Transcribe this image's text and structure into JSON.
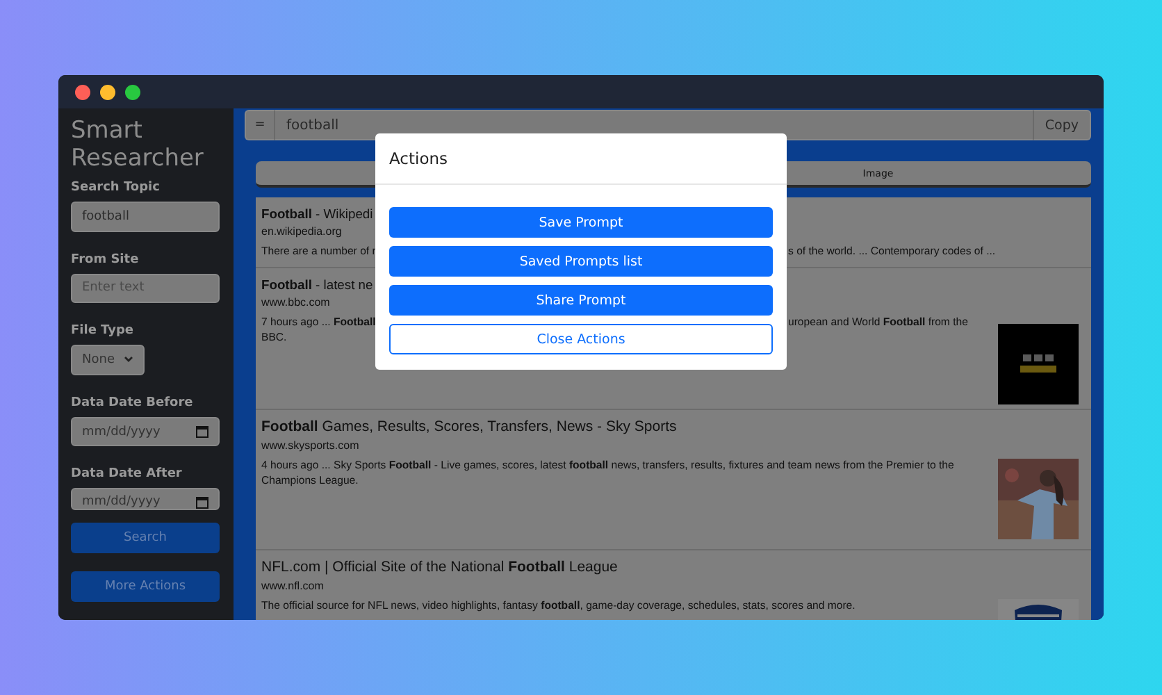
{
  "sidebar": {
    "title": "Smart Researcher",
    "fields": [
      {
        "kind": "text",
        "label": "Search Topic",
        "value": "football"
      },
      {
        "kind": "text",
        "label": "From Site",
        "placeholder": "Enter text"
      },
      {
        "kind": "select",
        "label": "File Type",
        "value": "None"
      },
      {
        "kind": "date",
        "label": "Data Date Before",
        "placeholder": "mm/dd/yyyy"
      },
      {
        "kind": "date",
        "label": "Data Date After",
        "placeholder": "mm/dd/yyyy"
      }
    ],
    "buttons": [
      "Search",
      "More Actions"
    ]
  },
  "query_bar": {
    "prefix": "=",
    "value": "football",
    "action": "Copy"
  },
  "tabs": [
    {
      "label": "Image"
    }
  ],
  "results": [
    {
      "title": [
        {
          "left": "**Football** - Wikipedi"
        }
      ],
      "url": "en.wikipedia.org",
      "snippet": [
        {
          "left": "There are a number of r",
          "right": "s of the world. ... Contemporary codes of ..."
        }
      ]
    },
    {
      "title": [
        {
          "left": "**Football** - latest ne"
        }
      ],
      "url": "www.bbc.com",
      "snippet": [
        {
          "left": "7 hours ago ... **Football**",
          "right": "uropean and World **Football** from the"
        },
        {
          "left": "BBC."
        }
      ],
      "thumbnail": {
        "kind": "picture"
      }
    },
    {
      "title": [
        {
          "left": "**Football** Games, Results, Scores, Transfers, News - Sky Sports"
        }
      ],
      "url": "www.skysports.com",
      "snippet": [
        {
          "left": "4 hours ago ... Sky Sports **Football** - Live games, scores, latest **football** news, transfers, results, fixtures and team news from the Premier to the Champions League."
        }
      ],
      "thumbnail": {
        "kind": "picture"
      }
    },
    {
      "title": [
        {
          "left": "NFL.com | Official Site of the National **Football** League"
        }
      ],
      "url": "www.nfl.com",
      "snippet": [
        {
          "left": "The official source for NFL news, video highlights, fantasy **football**, game-day coverage, schedules, stats, scores and more."
        }
      ],
      "thumbnail": {
        "kind": "picture"
      }
    }
  ],
  "modal": {
    "title": "Actions",
    "buttons": [
      {
        "label": "Save Prompt",
        "kind": "primary"
      },
      {
        "label": "Saved Prompts list",
        "kind": "primary"
      },
      {
        "label": "Share Prompt",
        "kind": "primary"
      },
      {
        "label": "Close Actions",
        "kind": "outline"
      }
    ]
  }
}
